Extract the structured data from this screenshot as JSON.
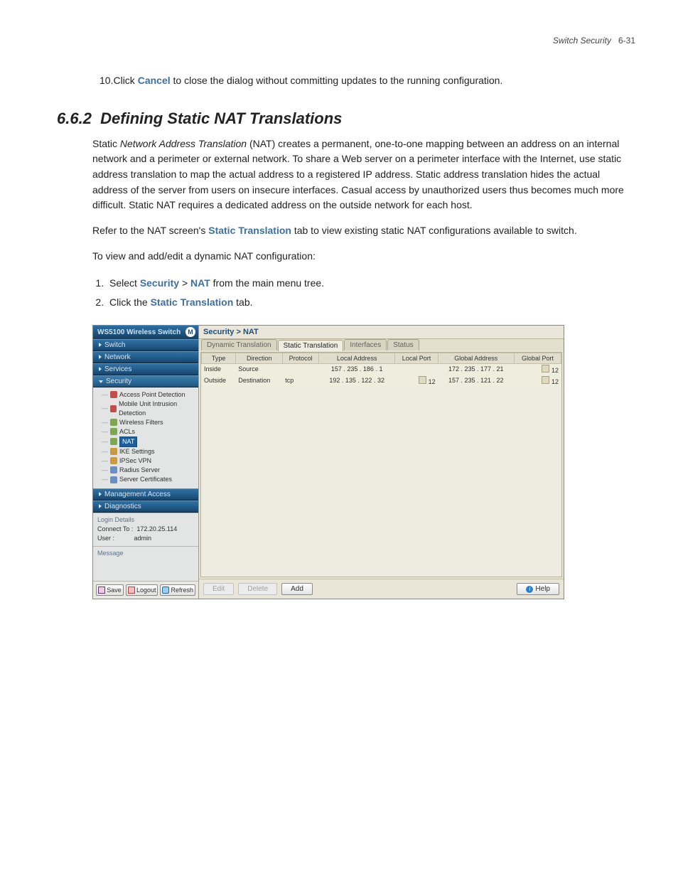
{
  "header": {
    "label": "Switch Security",
    "page": "6-31"
  },
  "step10": {
    "num": "10.",
    "pre": "Click ",
    "bold": "Cancel",
    "post": " to close the dialog without committing updates to the running configuration."
  },
  "section": {
    "num": "6.6.2",
    "title": "Defining Static NAT Translations"
  },
  "p1": {
    "pre": "Static ",
    "ital": "Network Address Translation",
    "post": " (NAT) creates a permanent, one-to-one mapping between an address on an internal network and a perimeter or external network. To share a Web server on a perimeter interface with the Internet, use static address translation to map the actual address to a registered IP address. Static address translation hides the actual address of the server from users on insecure interfaces. Casual access by unauthorized users thus becomes much more difficult. Static NAT requires a dedicated address on the outside network for each host."
  },
  "p2": {
    "pre": "Refer to the NAT screen's ",
    "bold": "Static Translation",
    "post": " tab to view existing static NAT configurations available to switch."
  },
  "p3": {
    "text": "To view and add/edit a dynamic NAT configuration:"
  },
  "steps": {
    "s1": {
      "pre": "Select ",
      "b1": "Security",
      "gt": " > ",
      "b2": "NAT",
      "post": " from the main menu tree."
    },
    "s2": {
      "pre": "Click the ",
      "b1": "Static Translation",
      "post": " tab."
    }
  },
  "shot": {
    "title": "WS5100 Wireless Switch",
    "nav": {
      "sections": [
        "Switch",
        "Network",
        "Services",
        "Security",
        "Management Access",
        "Diagnostics"
      ],
      "tree": [
        {
          "icon": "red",
          "label": "Access Point Detection"
        },
        {
          "icon": "red",
          "label": "Mobile Unit Intrusion Detection"
        },
        {
          "icon": "green",
          "label": "Wireless Filters"
        },
        {
          "icon": "green",
          "label": "ACLs"
        },
        {
          "icon": "green",
          "label": "NAT",
          "selected": true
        },
        {
          "icon": "lock",
          "label": "IKE Settings"
        },
        {
          "icon": "lock",
          "label": "IPSec VPN"
        },
        {
          "icon": "blue",
          "label": "Radius Server"
        },
        {
          "icon": "blue",
          "label": "Server Certificates"
        }
      ],
      "login": {
        "legend": "Login Details",
        "connect_lbl": "Connect To :",
        "connect_val": "172.20.25.114",
        "user_lbl": "User :",
        "user_val": "admin"
      },
      "msg": "Message",
      "btns": {
        "save": "Save",
        "logout": "Logout",
        "refresh": "Refresh"
      }
    },
    "crumb": "Security > NAT",
    "tabs": [
      "Dynamic Translation",
      "Static Translation",
      "Interfaces",
      "Status"
    ],
    "cols": [
      "Type",
      "Direction",
      "Protocol",
      "Local Address",
      "Local Port",
      "Global Address",
      "Global Port"
    ],
    "rows": [
      {
        "type": "Inside",
        "dir": "Source",
        "proto": "",
        "laddr": "157 . 235 . 186 .  1",
        "lport": "",
        "gaddr": "172 . 235 . 177 . 21",
        "gport": "12"
      },
      {
        "type": "Outside",
        "dir": "Destination",
        "proto": "tcp",
        "laddr": "192 . 135 . 122 . 32",
        "lport": "12",
        "gaddr": "157 . 235 . 121 . 22",
        "gport": "12"
      }
    ],
    "btns": {
      "edit": "Edit",
      "delete": "Delete",
      "add": "Add",
      "help": "Help"
    }
  }
}
